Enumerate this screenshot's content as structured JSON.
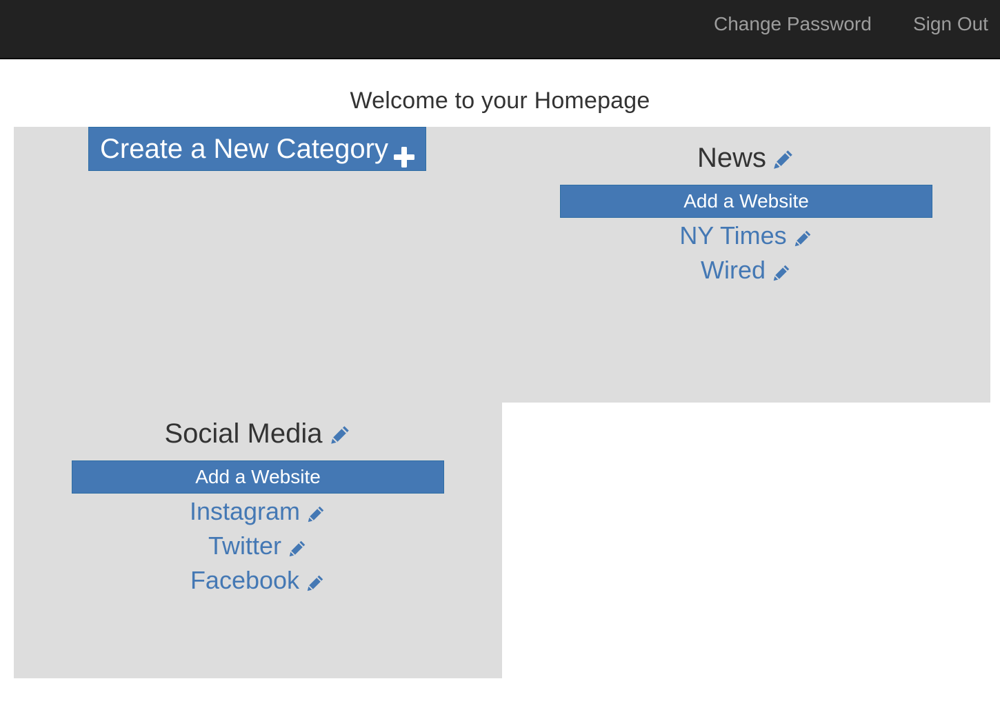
{
  "nav": {
    "change_password": "Change Password",
    "sign_out": "Sign Out"
  },
  "page": {
    "title": "Welcome to your Homepage"
  },
  "create_category": {
    "label": "Create a New Category",
    "icon": "plus-icon"
  },
  "categories": [
    {
      "title": "News",
      "add_label": "Add a Website",
      "sites": [
        "NY Times",
        "Wired"
      ]
    },
    {
      "title": "Social Media",
      "add_label": "Add a Website",
      "sites": [
        "Instagram",
        "Twitter",
        "Facebook"
      ]
    }
  ],
  "colors": {
    "navbar": "#222222",
    "nav_text": "#9d9d9d",
    "accent": "#4478b4",
    "tile": "#dddddd",
    "text": "#333333"
  }
}
